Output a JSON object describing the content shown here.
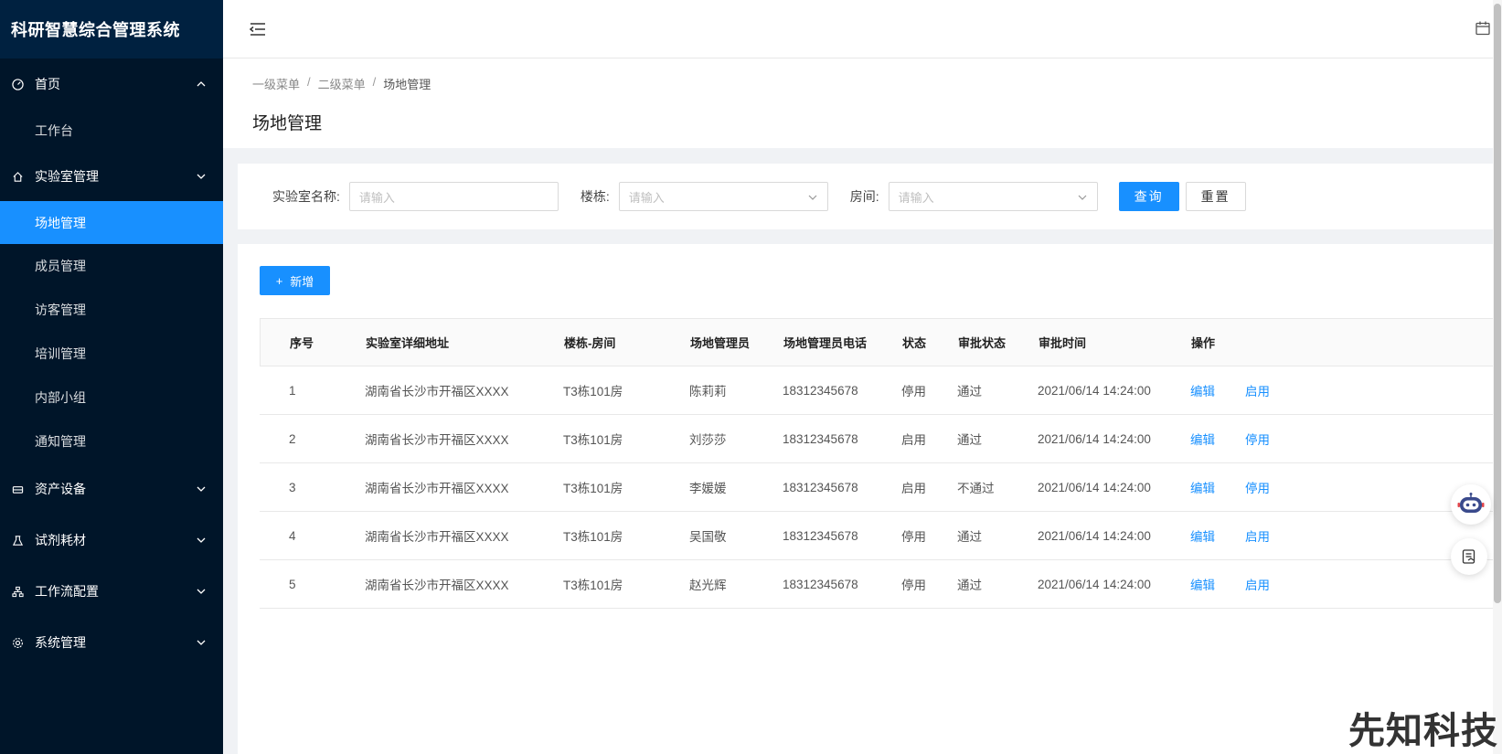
{
  "app": {
    "title": "科研智慧综合管理系统"
  },
  "sidebar": {
    "items": [
      {
        "label": "首页",
        "icon": "dashboard-icon",
        "type": "group",
        "expanded": true
      },
      {
        "label": "工作台",
        "type": "sub"
      },
      {
        "label": "实验室管理",
        "icon": "home-icon",
        "type": "group",
        "expanded": false
      },
      {
        "label": "场地管理",
        "type": "sub",
        "active": true
      },
      {
        "label": "成员管理",
        "type": "sub"
      },
      {
        "label": "访客管理",
        "type": "sub"
      },
      {
        "label": "培训管理",
        "type": "sub"
      },
      {
        "label": "内部小组",
        "type": "sub"
      },
      {
        "label": "通知管理",
        "type": "sub"
      },
      {
        "label": "资产设备",
        "icon": "hdd-icon",
        "type": "group",
        "expanded": false
      },
      {
        "label": "试剂耗材",
        "icon": "flask-icon",
        "type": "group",
        "expanded": false
      },
      {
        "label": "工作流配置",
        "icon": "cluster-icon",
        "type": "group",
        "expanded": false
      },
      {
        "label": "系统管理",
        "icon": "gear-icon",
        "type": "group",
        "expanded": false
      }
    ]
  },
  "breadcrumb": [
    "一级菜单",
    "二级菜单",
    "场地管理"
  ],
  "page": {
    "title": "场地管理"
  },
  "search": {
    "lab_label": "实验室名称:",
    "lab_placeholder": "请输入",
    "building_label": "楼栋:",
    "building_placeholder": "请输入",
    "room_label": "房间:",
    "room_placeholder": "请输入",
    "query_label": "查询",
    "reset_label": "重置"
  },
  "toolbar": {
    "add_label": "新增",
    "add_icon": "+"
  },
  "table": {
    "columns": [
      "序号",
      "实验室详细地址",
      "楼栋-房间",
      "场地管理员",
      "场地管理员电话",
      "状态",
      "审批状态",
      "审批时间",
      "操作"
    ],
    "rows": [
      {
        "index": "1",
        "address": "湖南省长沙市开福区XXXX",
        "room": "T3栋101房",
        "manager": "陈莉莉",
        "phone": "18312345678",
        "status": "停用",
        "approval": "通过",
        "time": "2021/06/14 14:24:00",
        "edit": "编辑",
        "toggle": "启用"
      },
      {
        "index": "2",
        "address": "湖南省长沙市开福区XXXX",
        "room": "T3栋101房",
        "manager": "刘莎莎",
        "phone": "18312345678",
        "status": "启用",
        "approval": "通过",
        "time": "2021/06/14 14:24:00",
        "edit": "编辑",
        "toggle": "停用"
      },
      {
        "index": "3",
        "address": "湖南省长沙市开福区XXXX",
        "room": "T3栋101房",
        "manager": "李媛媛",
        "phone": "18312345678",
        "status": "启用",
        "approval": "不通过",
        "time": "2021/06/14 14:24:00",
        "edit": "编辑",
        "toggle": "停用"
      },
      {
        "index": "4",
        "address": "湖南省长沙市开福区XXXX",
        "room": "T3栋101房",
        "manager": "吴国敬",
        "phone": "18312345678",
        "status": "停用",
        "approval": "通过",
        "time": "2021/06/14 14:24:00",
        "edit": "编辑",
        "toggle": "启用"
      },
      {
        "index": "5",
        "address": "湖南省长沙市开福区XXXX",
        "room": "T3栋101房",
        "manager": "赵光辉",
        "phone": "18312345678",
        "status": "停用",
        "approval": "通过",
        "time": "2021/06/14 14:24:00",
        "edit": "编辑",
        "toggle": "启用"
      }
    ]
  },
  "watermark": "先知科技",
  "colors": {
    "sidebar": "#001529",
    "accent": "#1890ff",
    "logo_bg": "#002140"
  }
}
